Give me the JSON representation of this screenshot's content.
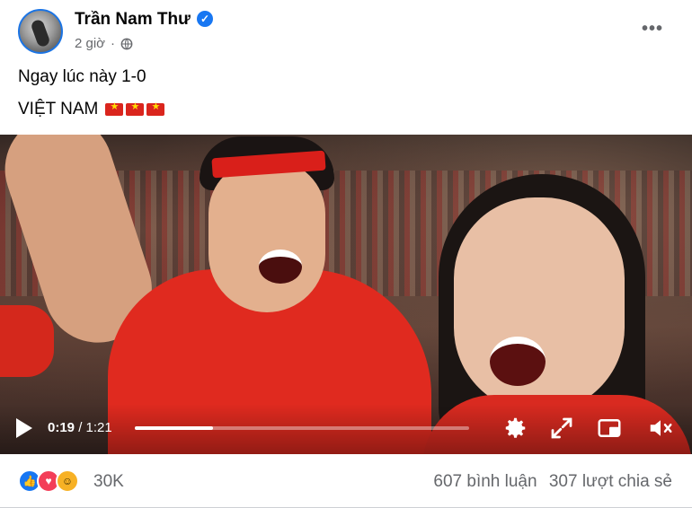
{
  "post": {
    "author": "Trần Nam Thư",
    "time": "2 giờ",
    "line1": "Ngay lúc này 1-0",
    "line2": "VIỆT NAM"
  },
  "video": {
    "current_time": "0:19",
    "duration": "/ 1:21",
    "progress_fraction": 0.234
  },
  "footer": {
    "reaction_count": "30K",
    "comments": "607 bình luận",
    "shares": "307 lượt chia sẻ"
  },
  "colors": {
    "accent": "#1877f2",
    "video_red": "#e02a1f"
  },
  "icons": [
    "verified-icon",
    "globe-icon",
    "more-icon",
    "flag-icon",
    "play-icon",
    "settings-icon",
    "fullscreen-icon",
    "miniplayer-icon",
    "mute-icon",
    "like-icon",
    "love-icon",
    "haha-icon"
  ]
}
